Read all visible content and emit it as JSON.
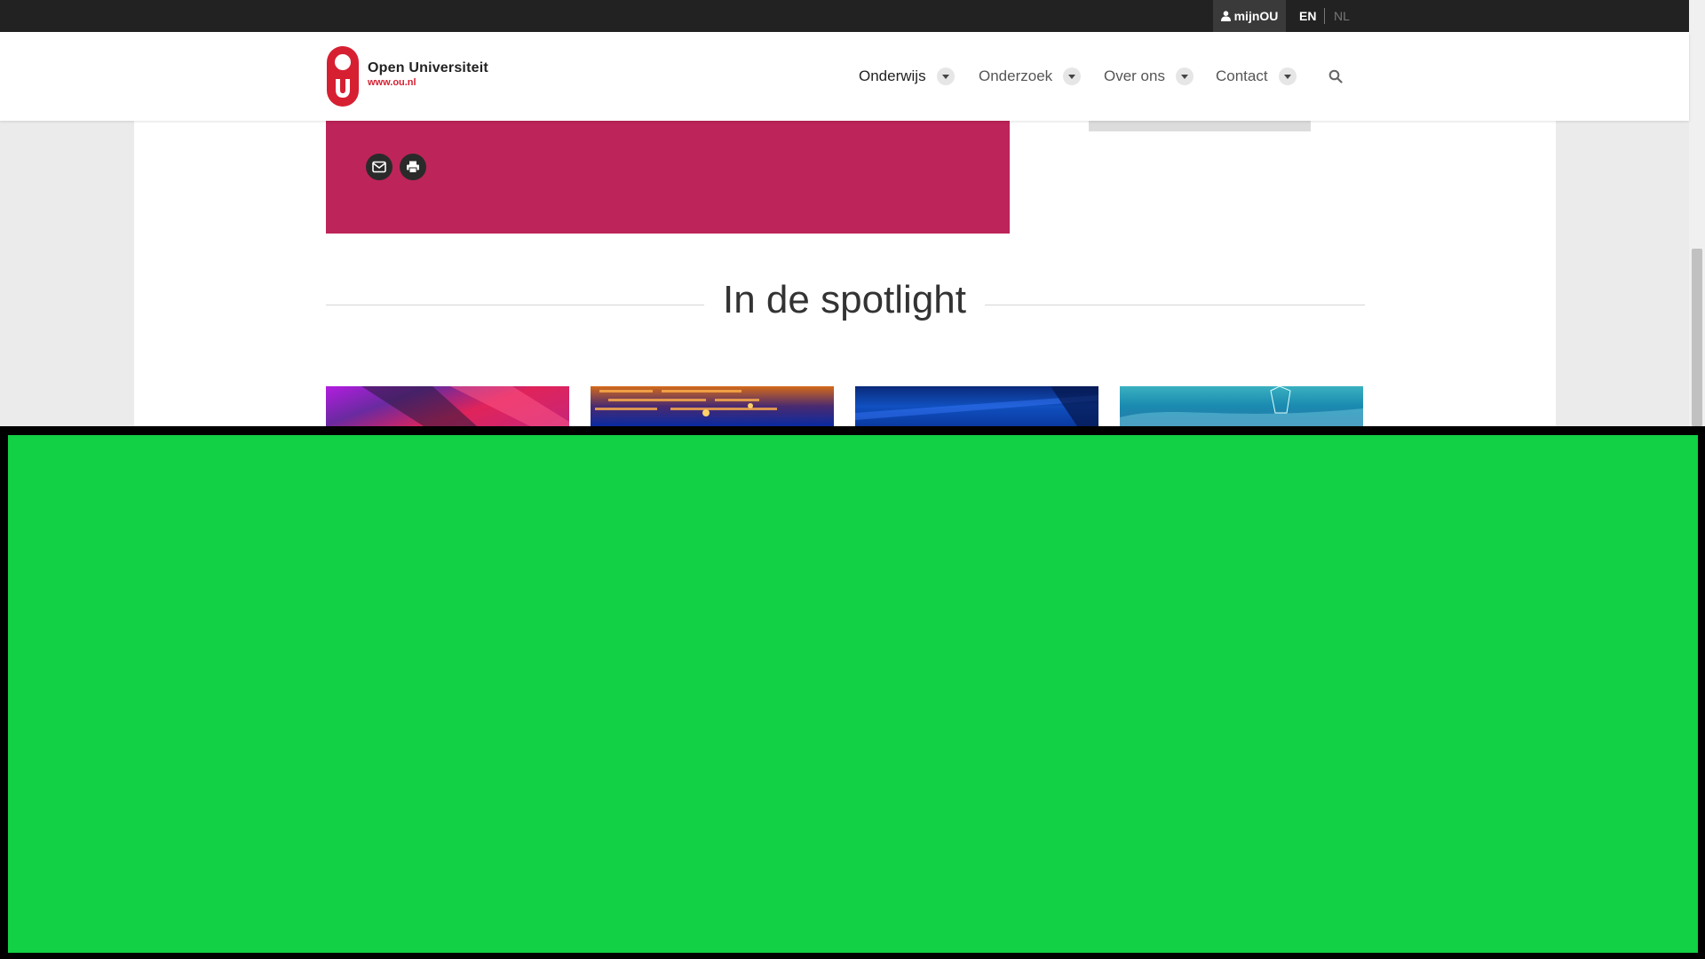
{
  "topbar": {
    "account_label": "mijnOU",
    "languages": [
      "EN",
      "NL"
    ],
    "active_language": "EN"
  },
  "header": {
    "logo_name": "Open Universiteit",
    "logo_url": "www.ou.nl",
    "brand_color": "#d62032",
    "nav": [
      {
        "label": "Onderwijs",
        "active": true
      },
      {
        "label": "Onderzoek",
        "active": false
      },
      {
        "label": "Over ons",
        "active": false
      },
      {
        "label": "Contact",
        "active": false
      }
    ],
    "search_icon": "search-icon"
  },
  "share": {
    "icons": [
      "mail-icon",
      "print-icon"
    ],
    "panel_color": "#bd2459"
  },
  "spotlight": {
    "title": "In de spotlight"
  },
  "overlay": {
    "color": "#12d144"
  }
}
